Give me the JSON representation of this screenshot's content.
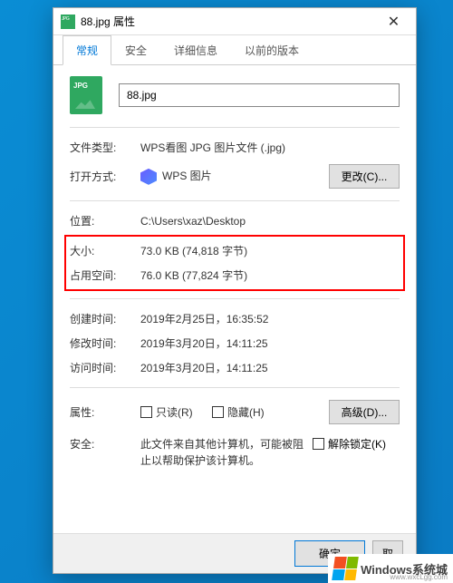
{
  "window": {
    "title": "88.jpg 属性",
    "close": "✕"
  },
  "tabs": [
    {
      "label": "常规",
      "active": true
    },
    {
      "label": "安全",
      "active": false
    },
    {
      "label": "详细信息",
      "active": false
    },
    {
      "label": "以前的版本",
      "active": false
    }
  ],
  "file": {
    "name": "88.jpg"
  },
  "fields": {
    "type_label": "文件类型:",
    "type_value": "WPS看图 JPG 图片文件 (.jpg)",
    "opens_with_label": "打开方式:",
    "opens_with_value": "WPS 图片",
    "change_btn": "更改(C)...",
    "location_label": "位置:",
    "location_value": "C:\\Users\\xaz\\Desktop",
    "size_label": "大小:",
    "size_value": "73.0 KB (74,818 字节)",
    "size_on_disk_label": "占用空间:",
    "size_on_disk_value": "76.0 KB (77,824 字节)",
    "created_label": "创建时间:",
    "created_value": "2019年2月25日，16:35:52",
    "modified_label": "修改时间:",
    "modified_value": "2019年3月20日，14:11:25",
    "accessed_label": "访问时间:",
    "accessed_value": "2019年3月20日，14:11:25",
    "attributes_label": "属性:",
    "readonly": "只读(R)",
    "hidden": "隐藏(H)",
    "advanced_btn": "高级(D)...",
    "security_label": "安全:",
    "security_text": "此文件来自其他计算机，可能被阻止以帮助保护该计算机。",
    "unblock": "解除锁定(K)"
  },
  "footer": {
    "ok": "确定",
    "cancel_partial": "取"
  },
  "watermark": {
    "text": "Windows系统城",
    "sub": "www.wxcLgg.com"
  }
}
